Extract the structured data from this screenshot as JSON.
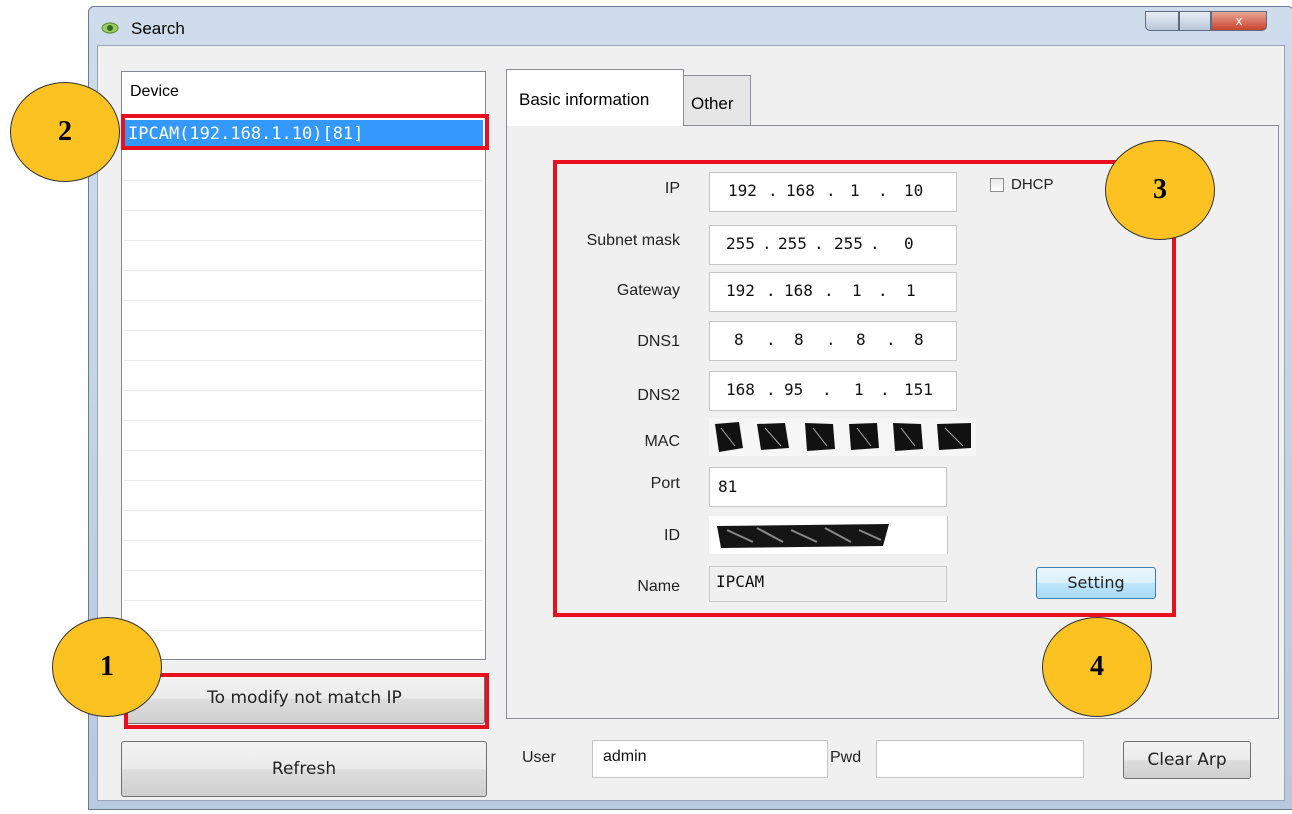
{
  "window": {
    "title": "Search",
    "close_glyph": "x"
  },
  "device_list": {
    "header": "Device",
    "items": [
      {
        "label": "IPCAM(192.168.1.10)[81]",
        "selected": true
      }
    ]
  },
  "buttons": {
    "modify_ip": "To modify not match IP",
    "refresh": "Refresh",
    "setting": "Setting",
    "clear_arp": "Clear Arp"
  },
  "tabs": [
    {
      "label": "Basic information",
      "active": true
    },
    {
      "label": "Other",
      "active": false
    }
  ],
  "form": {
    "ip_label": "IP",
    "ip": [
      "192",
      "168",
      "1",
      "10"
    ],
    "subnet_label": "Subnet mask",
    "subnet": [
      "255",
      "255",
      "255",
      "0"
    ],
    "gateway_label": "Gateway",
    "gateway": [
      "192",
      "168",
      "1",
      "1"
    ],
    "dns1_label": "DNS1",
    "dns1": [
      "8",
      "8",
      "8",
      "8"
    ],
    "dns2_label": "DNS2",
    "dns2": [
      "168",
      "95",
      "1",
      "151"
    ],
    "mac_label": "MAC",
    "port_label": "Port",
    "port": "81",
    "id_label": "ID",
    "name_label": "Name",
    "name": "IPCAM",
    "dhcp_label": "DHCP",
    "dhcp_checked": false
  },
  "login": {
    "user_label": "User",
    "user": "admin",
    "pwd_label": "Pwd",
    "pwd": ""
  },
  "annotations": {
    "badge1": "1",
    "badge2": "2",
    "badge3": "3",
    "badge4": "4"
  },
  "colors": {
    "highlight_red": "#e8101e",
    "badge_fill": "#fbc221",
    "selection_blue": "#3399ff"
  }
}
